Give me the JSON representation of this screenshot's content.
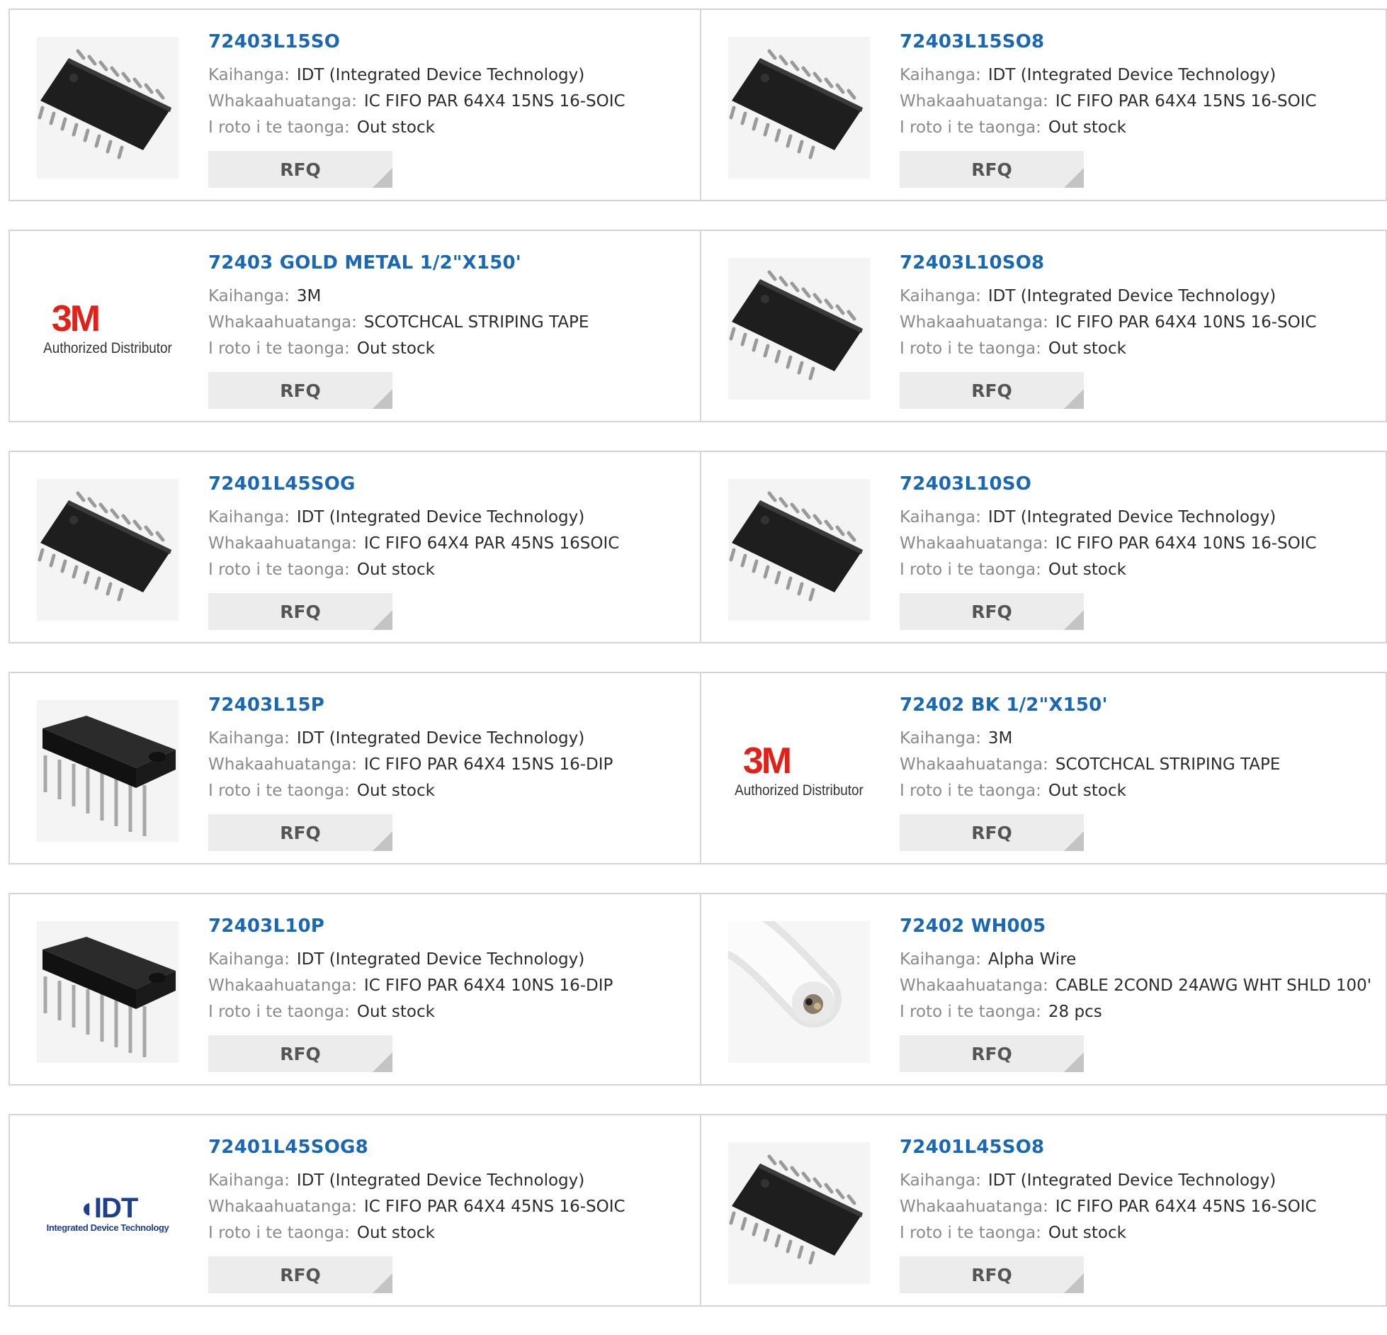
{
  "labels": {
    "manufacturer": "Kaihanga:",
    "description": "Whakaahuatanga:",
    "stock": "I roto i te taonga:",
    "rfq": "RFQ"
  },
  "logos": {
    "three_m": {
      "mark": "3M",
      "sub": "Authorized Distributor"
    },
    "idt": {
      "mark": "IDT",
      "sub": "Integrated Device Technology"
    }
  },
  "products": [
    {
      "part": "72403L15SO",
      "manufacturer": "IDT (Integrated Device Technology)",
      "description": "IC FIFO PAR 64X4 15NS 16-SOIC",
      "stock": "Out stock",
      "image": "soic-chip"
    },
    {
      "part": "72403L15SO8",
      "manufacturer": "IDT (Integrated Device Technology)",
      "description": "IC FIFO PAR 64X4 15NS 16-SOIC",
      "stock": "Out stock",
      "image": "soic-chip"
    },
    {
      "part": "72403 GOLD METAL 1/2\"X150'",
      "manufacturer": "3M",
      "description": "SCOTCHCAL STRIPING TAPE",
      "stock": "Out stock",
      "image": "3m-logo"
    },
    {
      "part": "72403L10SO8",
      "manufacturer": "IDT (Integrated Device Technology)",
      "description": "IC FIFO PAR 64X4 10NS 16-SOIC",
      "stock": "Out stock",
      "image": "soic-chip"
    },
    {
      "part": "72401L45SOG",
      "manufacturer": "IDT (Integrated Device Technology)",
      "description": "IC FIFO 64X4 PAR 45NS 16SOIC",
      "stock": "Out stock",
      "image": "soic-chip"
    },
    {
      "part": "72403L10SO",
      "manufacturer": "IDT (Integrated Device Technology)",
      "description": "IC FIFO PAR 64X4 10NS 16-SOIC",
      "stock": "Out stock",
      "image": "soic-chip"
    },
    {
      "part": "72403L15P",
      "manufacturer": "IDT (Integrated Device Technology)",
      "description": "IC FIFO PAR 64X4 15NS 16-DIP",
      "stock": "Out stock",
      "image": "dip-chip"
    },
    {
      "part": "72402 BK 1/2\"X150'",
      "manufacturer": "3M",
      "description": "SCOTCHCAL STRIPING TAPE",
      "stock": "Out stock",
      "image": "3m-logo"
    },
    {
      "part": "72403L10P",
      "manufacturer": "IDT (Integrated Device Technology)",
      "description": "IC FIFO PAR 64X4 10NS 16-DIP",
      "stock": "Out stock",
      "image": "dip-chip"
    },
    {
      "part": "72402 WH005",
      "manufacturer": "Alpha Wire",
      "description": "CABLE 2COND 24AWG WHT SHLD 100'",
      "stock": "28 pcs",
      "image": "white-cable"
    },
    {
      "part": "72401L45SOG8",
      "manufacturer": "IDT (Integrated Device Technology)",
      "description": "IC FIFO PAR 64X4 45NS 16-SOIC",
      "stock": "Out stock",
      "image": "idt-logo"
    },
    {
      "part": "72401L45SO8",
      "manufacturer": "IDT (Integrated Device Technology)",
      "description": "IC FIFO PAR 64X4 45NS 16-SOIC",
      "stock": "Out stock",
      "image": "soic-chip"
    }
  ],
  "colors": {
    "title": "#1a68b3",
    "label": "#8a8a8a",
    "value": "#2b2b2b",
    "rfq_bg": "#ececec",
    "border": "#d5d5d5",
    "logo_3m": "#e02118",
    "logo_idt": "#1f3f8e"
  }
}
